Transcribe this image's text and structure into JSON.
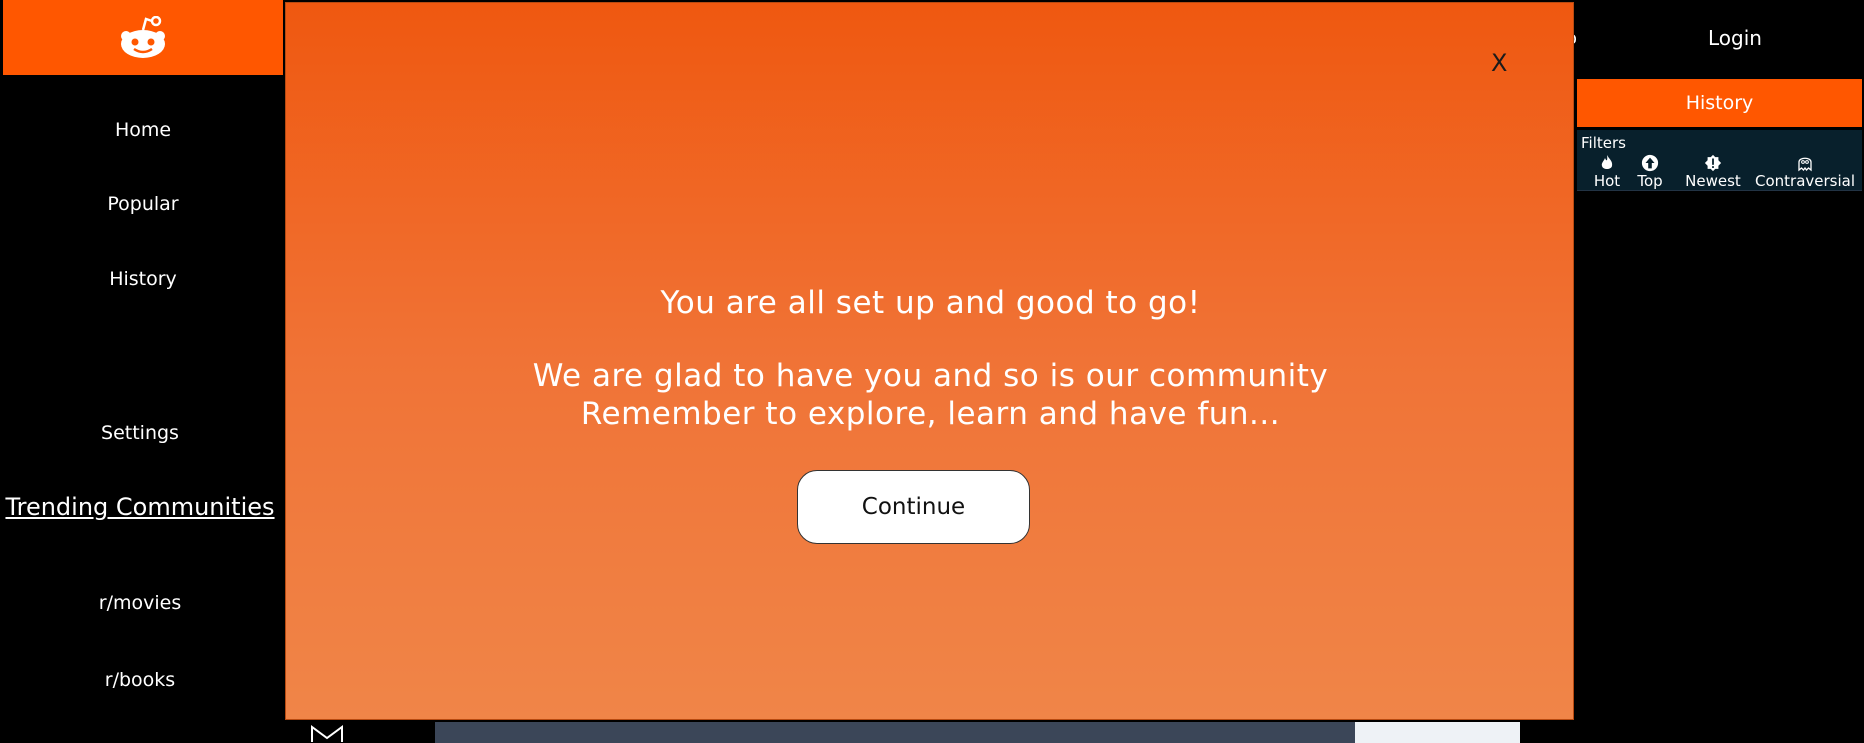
{
  "sidebar": {
    "items": [
      {
        "label": "Home"
      },
      {
        "label": "Popular"
      },
      {
        "label": "History"
      },
      {
        "label": "Settings"
      }
    ],
    "trending_title": "Trending Communities",
    "communities": [
      {
        "label": "r/movies"
      },
      {
        "label": "r/books"
      }
    ]
  },
  "header": {
    "login_label": "Login",
    "partial_label": "o"
  },
  "right_panel": {
    "history_tab": "History",
    "filters_title": "Filters",
    "filters": [
      {
        "label": "Hot",
        "icon": "flame-icon"
      },
      {
        "label": "Top",
        "icon": "arrow-up-circle-icon"
      },
      {
        "label": "Newest",
        "icon": "alert-badge-icon"
      },
      {
        "label": "Contraversial",
        "icon": "ghost-icon"
      }
    ]
  },
  "modal": {
    "close_label": "X",
    "headline": "You are all set up and good to go!",
    "line1": "We are glad to have you and so is our community",
    "line2": "Remember to explore, learn and have fun...",
    "continue_label": "Continue"
  },
  "colors": {
    "brand": "#ff5700",
    "panel_dark": "#08202c",
    "background": "#000000"
  }
}
